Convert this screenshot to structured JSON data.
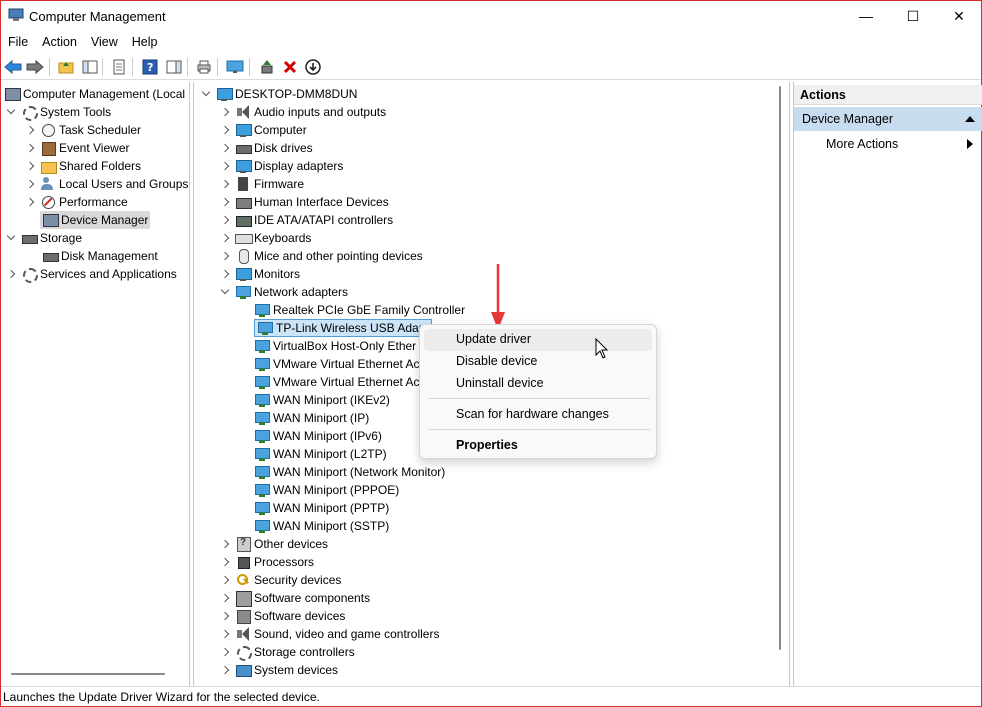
{
  "window": {
    "title": "Computer Management",
    "min_glyph": "—",
    "max_glyph": "☐",
    "close_glyph": "✕"
  },
  "menu": [
    "File",
    "Action",
    "View",
    "Help"
  ],
  "left_tree": {
    "root": "Computer Management (Local",
    "system_tools": "System Tools",
    "task_scheduler": "Task Scheduler",
    "event_viewer": "Event Viewer",
    "shared_folders": "Shared Folders",
    "local_users": "Local Users and Groups",
    "performance": "Performance",
    "device_manager": "Device Manager",
    "storage": "Storage",
    "disk_management": "Disk Management",
    "services": "Services and Applications"
  },
  "device_tree": {
    "root": "DESKTOP-DMM8DUN",
    "categories_top": [
      {
        "label": "Audio inputs and outputs",
        "icon": "audio"
      },
      {
        "label": "Computer",
        "icon": "mon"
      },
      {
        "label": "Disk drives",
        "icon": "disk"
      },
      {
        "label": "Display adapters",
        "icon": "mon"
      },
      {
        "label": "Firmware",
        "icon": "fw"
      },
      {
        "label": "Human Interface Devices",
        "icon": "hid"
      },
      {
        "label": "IDE ATA/ATAPI controllers",
        "icon": "ide"
      },
      {
        "label": "Keyboards",
        "icon": "kbd"
      },
      {
        "label": "Mice and other pointing devices",
        "icon": "mouse"
      },
      {
        "label": "Monitors",
        "icon": "mon"
      },
      {
        "label": "Network adapters",
        "icon": "net"
      }
    ],
    "network_adapters": [
      "Realtek PCIe GbE Family Controller",
      "TP-Link Wireless USB Adapt",
      "VirtualBox Host-Only Ether",
      "VMware Virtual Ethernet Ac",
      "VMware Virtual Ethernet Ac",
      "WAN Miniport (IKEv2)",
      "WAN Miniport (IP)",
      "WAN Miniport (IPv6)",
      "WAN Miniport (L2TP)",
      "WAN Miniport (Network Monitor)",
      "WAN Miniport (PPPOE)",
      "WAN Miniport (PPTP)",
      "WAN Miniport (SSTP)"
    ],
    "categories_bottom": [
      {
        "label": "Other devices",
        "icon": "warn"
      },
      {
        "label": "Processors",
        "icon": "cpu"
      },
      {
        "label": "Security devices",
        "icon": "key"
      },
      {
        "label": "Software components",
        "icon": "comp"
      },
      {
        "label": "Software devices",
        "icon": "gen"
      },
      {
        "label": "Sound, video and game controllers",
        "icon": "audio"
      },
      {
        "label": "Storage controllers",
        "icon": "gear"
      },
      {
        "label": "System devices",
        "icon": "sys"
      }
    ]
  },
  "actions": {
    "header": "Actions",
    "section": "Device Manager",
    "more": "More Actions"
  },
  "context_menu": {
    "update": "Update driver",
    "disable": "Disable device",
    "uninstall": "Uninstall device",
    "scan": "Scan for hardware changes",
    "properties": "Properties"
  },
  "status": "Launches the Update Driver Wizard for the selected device.",
  "colors": {
    "accent_red": "#d32f2f",
    "selection_blue": "#cce4f7",
    "actions_header_blue": "#c8dcef"
  }
}
